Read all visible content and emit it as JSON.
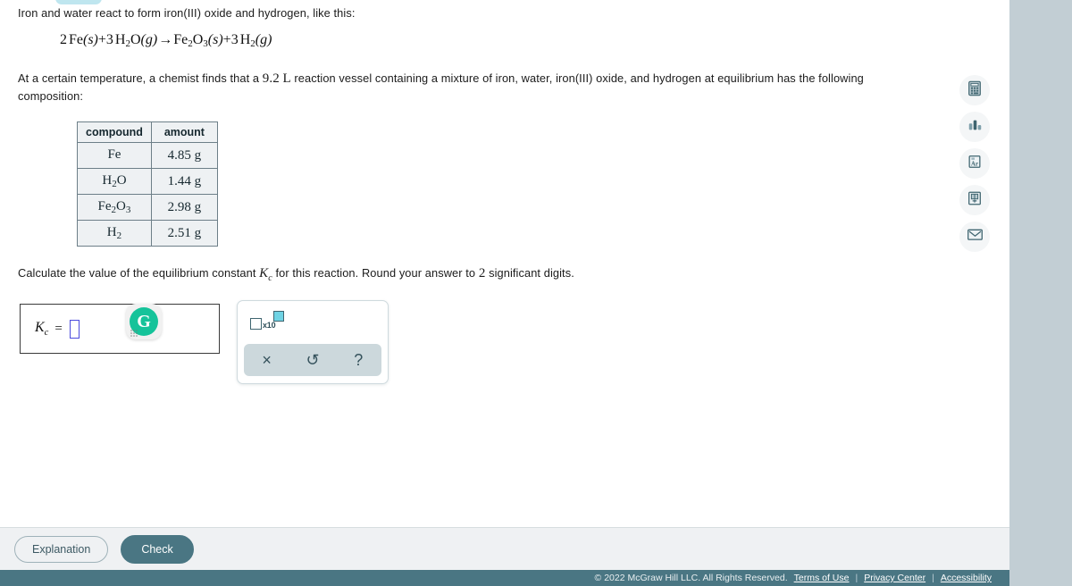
{
  "problem": {
    "intro": "Iron and water react to form iron(III) oxide and hydrogen, like this:",
    "equation": {
      "coef_fe": "2",
      "fe": "Fe",
      "fe_state": "(s)",
      "plus1": "+",
      "coef_h2o": "3",
      "h2o_h": "H",
      "h2o_sub": "2",
      "h2o_o": "O",
      "h2o_state": "(g)",
      "arrow": "→",
      "fe2o3_fe": "Fe",
      "fe2o3_sub1": "2",
      "fe2o3_o": "O",
      "fe2o3_sub2": "3",
      "fe2o3_state": "(s)",
      "plus2": "+",
      "coef_h2": "3",
      "h2_h": "H",
      "h2_sub": "2",
      "h2_state": "(g)"
    },
    "paragraph_part1": "At a certain temperature, a chemist finds that a",
    "volume_value": "9.2",
    "volume_unit": "L",
    "paragraph_part2": "reaction vessel containing a mixture of iron, water, iron(III) oxide, and hydrogen at equilibrium has the following composition:",
    "ask_part1": "Calculate the value of the equilibrium constant",
    "ask_symbol": "K",
    "ask_symbol_sub": "c",
    "ask_part2": "for this reaction. Round your answer to",
    "sig_digits": "2",
    "ask_part3": "significant digits."
  },
  "table": {
    "headers": [
      "compound",
      "amount"
    ],
    "rows": [
      {
        "formula_main": "Fe",
        "formula_sub": "",
        "formula_tail": "",
        "formula_sub2": "",
        "amount": "4.85 g"
      },
      {
        "formula_main": "H",
        "formula_sub": "2",
        "formula_tail": "O",
        "formula_sub2": "",
        "amount": "1.44 g"
      },
      {
        "formula_main": "Fe",
        "formula_sub": "2",
        "formula_tail": "O",
        "formula_sub2": "3",
        "amount": "2.98 g"
      },
      {
        "formula_main": "H",
        "formula_sub": "2",
        "formula_tail": "",
        "formula_sub2": "",
        "amount": "2.51 g"
      }
    ]
  },
  "answer": {
    "label_symbol": "K",
    "label_sub": "c",
    "equals": "=",
    "input_value": "",
    "input_placeholder": ""
  },
  "grammarly": {
    "letter": "G",
    "color": "#15c39a"
  },
  "math_panel": {
    "scientific_notation_label": "x10",
    "keys": [
      {
        "name": "clear",
        "glyph": "×"
      },
      {
        "name": "undo",
        "glyph": "↺"
      },
      {
        "name": "help",
        "glyph": "?"
      }
    ]
  },
  "tool_rail": [
    {
      "name": "calculator-icon",
      "title": "Calculator"
    },
    {
      "name": "bar-chart-icon",
      "title": "Data"
    },
    {
      "name": "periodic-table-icon",
      "title": "Periodic Table",
      "element_symbol": "Ar"
    },
    {
      "name": "glossary-book-icon",
      "title": "Glossary"
    },
    {
      "name": "message-envelope-icon",
      "title": "Message"
    }
  ],
  "actions": {
    "explanation_label": "Explanation",
    "check_label": "Check"
  },
  "footer": {
    "copyright": "© 2022 McGraw Hill LLC. All Rights Reserved.",
    "links": [
      "Terms of Use",
      "Privacy Center",
      "Accessibility"
    ],
    "separator": "|"
  },
  "colors": {
    "accent": "#4a7683",
    "panel_bar": "#ccd8dc",
    "exponent_highlight": "#6fd3e4",
    "page_background": "#c2ced4"
  }
}
